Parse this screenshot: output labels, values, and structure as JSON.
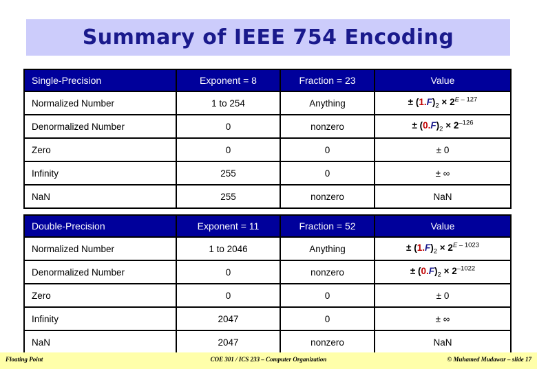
{
  "slide": {
    "title": "Summary of IEEE 754 Encoding"
  },
  "tables": [
    {
      "id": "single",
      "headers": {
        "category": "Single-Precision",
        "exponent": "Exponent = 8",
        "fraction": "Fraction = 23",
        "value": "Value"
      },
      "rows": [
        {
          "category": "Normalized Number",
          "exponent": "1 to 254",
          "fraction": "Anything",
          "value_text": "± (1.F)2 × 2E – 127",
          "value_parts": {
            "sign": "±",
            "open": "(",
            "mantissa": "1.",
            "fvar": "F",
            "close": ")",
            "base_sub": "2",
            "times": "×",
            "base": "2",
            "exp_var": "E",
            "exp_rest": " – 127"
          }
        },
        {
          "category": "Denormalized Number",
          "exponent": "0",
          "fraction": "nonzero",
          "value_text": "± (0.F)2 × 2–126",
          "value_parts": {
            "sign": "±",
            "open": "(",
            "mantissa": "0.",
            "fvar": "F",
            "close": ")",
            "base_sub": "2",
            "times": "×",
            "base": "2",
            "exp_var": "",
            "exp_rest": "–126"
          }
        },
        {
          "category": "Zero",
          "exponent": "0",
          "fraction": "0",
          "value_text": "± 0",
          "value_parts": null
        },
        {
          "category": "Infinity",
          "exponent": "255",
          "fraction": "0",
          "value_text": "± ∞",
          "value_parts": null
        },
        {
          "category": "NaN",
          "exponent": "255",
          "fraction": "nonzero",
          "value_text": "NaN",
          "value_parts": null
        }
      ]
    },
    {
      "id": "double",
      "headers": {
        "category": "Double-Precision",
        "exponent": "Exponent = 11",
        "fraction": "Fraction = 52",
        "value": "Value"
      },
      "rows": [
        {
          "category": "Normalized Number",
          "exponent": "1 to 2046",
          "fraction": "Anything",
          "value_text": "± (1.F)2 × 2E – 1023",
          "value_parts": {
            "sign": "±",
            "open": "(",
            "mantissa": "1.",
            "fvar": "F",
            "close": ")",
            "base_sub": "2",
            "times": "×",
            "base": "2",
            "exp_var": "E",
            "exp_rest": " – 1023"
          }
        },
        {
          "category": "Denormalized Number",
          "exponent": "0",
          "fraction": "nonzero",
          "value_text": "± (0.F)2 × 2–1022",
          "value_parts": {
            "sign": "±",
            "open": "(",
            "mantissa": "0.",
            "fvar": "F",
            "close": ")",
            "base_sub": "2",
            "times": "×",
            "base": "2",
            "exp_var": "",
            "exp_rest": "–1022"
          }
        },
        {
          "category": "Zero",
          "exponent": "0",
          "fraction": "0",
          "value_text": "± 0",
          "value_parts": null
        },
        {
          "category": "Infinity",
          "exponent": "2047",
          "fraction": "0",
          "value_text": "± ∞",
          "value_parts": null
        },
        {
          "category": "NaN",
          "exponent": "2047",
          "fraction": "nonzero",
          "value_text": "NaN",
          "value_parts": null
        }
      ]
    }
  ],
  "footer": {
    "left": "Floating Point",
    "center": "COE 301 / ICS 233 – Computer Organization",
    "right": "© Muhamed Mudawar – slide 17"
  },
  "colors": {
    "banner_bg": "#ccccfb",
    "title_text": "#1a1a8c",
    "header_bg": "#00009b",
    "header_text": "#ffffff",
    "mantissa_red": "#c00000",
    "fvar_blue": "#1a1a8c",
    "footer_bg": "#ffffaa"
  }
}
